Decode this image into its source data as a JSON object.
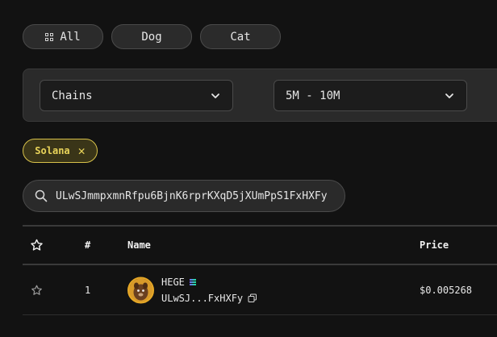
{
  "tabs": [
    {
      "label": "All",
      "icon": "grid-icon"
    },
    {
      "label": "Dog"
    },
    {
      "label": "Cat"
    }
  ],
  "filters": {
    "chains": {
      "value": "Chains"
    },
    "market_cap": {
      "value": "5M - 10M"
    }
  },
  "active_chip": {
    "label": "Solana",
    "close_icon": "close-icon"
  },
  "search": {
    "value": "ULwSJmmpxmnRfpu6BjnK6rprKXqD5jXUmPpS1FxHXFy"
  },
  "table": {
    "headers": {
      "star": "",
      "rank": "#",
      "name": "Name",
      "price": "Price"
    },
    "rows": [
      {
        "rank": "1",
        "name": "HEGE",
        "chain_icon": "solana-icon",
        "address": "ULwSJ...FxHXFy",
        "price": "$0.005268"
      }
    ]
  },
  "colors": {
    "background": "#121212",
    "chip_accent": "#e9d45a",
    "avatar_ring": "#e6a826"
  }
}
